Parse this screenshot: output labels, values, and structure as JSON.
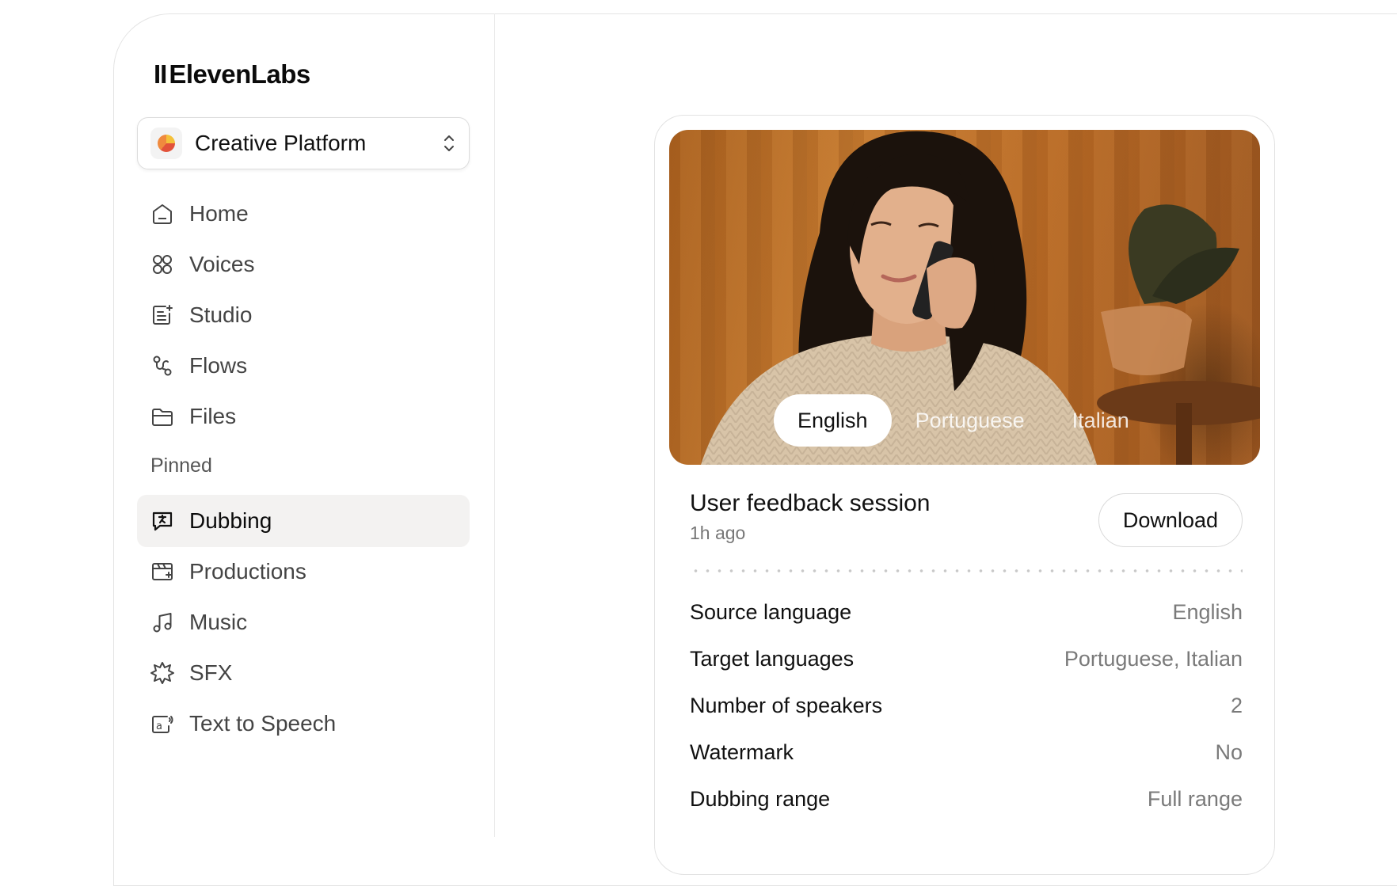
{
  "brand": {
    "name": "ElevenLabs"
  },
  "workspace": {
    "name": "Creative Platform"
  },
  "nav": {
    "items": [
      {
        "label": "Home",
        "icon": "home-icon"
      },
      {
        "label": "Voices",
        "icon": "voices-icon"
      },
      {
        "label": "Studio",
        "icon": "studio-icon"
      },
      {
        "label": "Flows",
        "icon": "flows-icon"
      },
      {
        "label": "Files",
        "icon": "files-icon"
      }
    ],
    "pinned_label": "Pinned",
    "pinned": [
      {
        "label": "Dubbing",
        "icon": "dubbing-icon",
        "active": true
      },
      {
        "label": "Productions",
        "icon": "productions-icon"
      },
      {
        "label": "Music",
        "icon": "music-icon"
      },
      {
        "label": "SFX",
        "icon": "sfx-icon"
      },
      {
        "label": "Text to Speech",
        "icon": "text-to-speech-icon"
      }
    ]
  },
  "card": {
    "languages": [
      "English",
      "Portuguese",
      "Italian"
    ],
    "selected_language": "English",
    "title": "User feedback session",
    "time": "1h ago",
    "download_label": "Download",
    "details": [
      {
        "key": "Source language",
        "value": "English"
      },
      {
        "key": "Target languages",
        "value": "Portuguese, Italian"
      },
      {
        "key": "Number of speakers",
        "value": "2"
      },
      {
        "key": "Watermark",
        "value": "No"
      },
      {
        "key": "Dubbing range",
        "value": "Full range"
      }
    ]
  },
  "colors": {
    "active_nav_bg": "#f3f2f1",
    "text": "#111111",
    "muted": "#7a7a7a"
  }
}
